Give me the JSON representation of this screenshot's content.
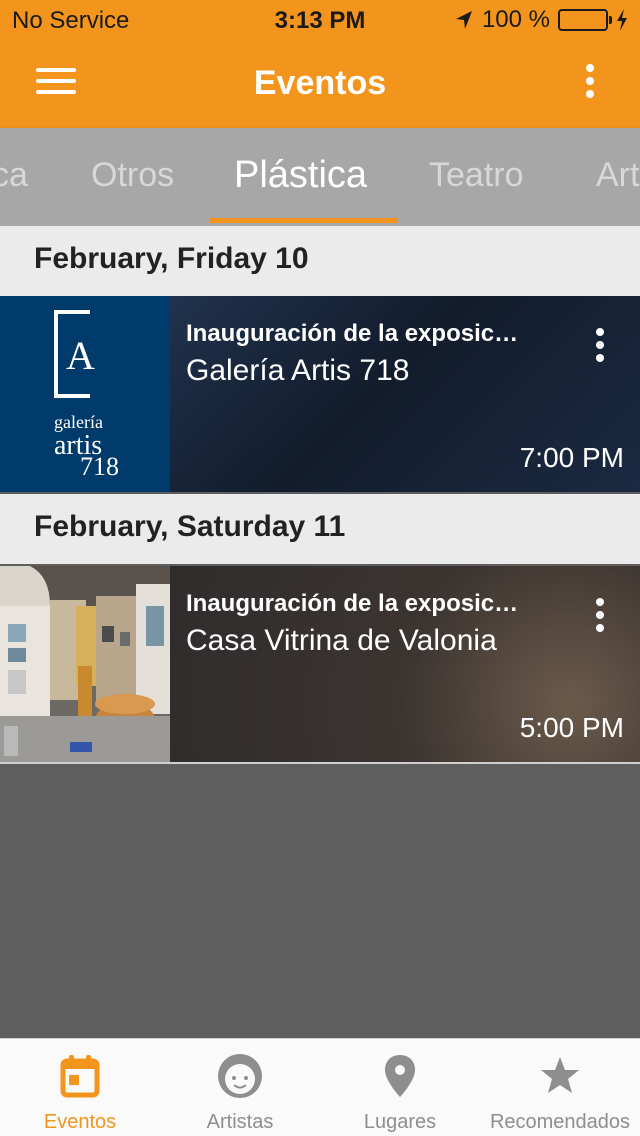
{
  "status_bar": {
    "carrier": "No Service",
    "time": "3:13 PM",
    "battery": "100 %",
    "battery_level": 1.0
  },
  "header": {
    "title": "Eventos",
    "menu_icon": "hamburger-menu-icon",
    "overflow_icon": "more-vertical-icon"
  },
  "category_tabs": [
    {
      "label": "ca",
      "active": false
    },
    {
      "label": "Otros",
      "active": false
    },
    {
      "label": "Plástica",
      "active": true
    },
    {
      "label": "Teatro",
      "active": false
    },
    {
      "label": "Art",
      "active": false
    }
  ],
  "sections": [
    {
      "date": "February, Friday 10",
      "events": [
        {
          "title": "Inauguración de la exposic…",
          "venue": "Galería Artis 718",
          "time": "7:00 PM",
          "logo": {
            "line1": "galería",
            "line2": "artis",
            "line3": "718",
            "mark": "A"
          }
        }
      ]
    },
    {
      "date": "February, Saturday 11",
      "events": [
        {
          "title": "Inauguración de la exposic…",
          "venue": "Casa Vitrina de Valonia",
          "time": "5:00 PM"
        }
      ]
    }
  ],
  "bottom_tabs": [
    {
      "label": "Eventos",
      "icon": "calendar-icon",
      "active": true
    },
    {
      "label": "Artistas",
      "icon": "face-icon",
      "active": false
    },
    {
      "label": "Lugares",
      "icon": "map-pin-icon",
      "active": false
    },
    {
      "label": "Recomendados",
      "icon": "star-icon",
      "active": false
    }
  ],
  "colors": {
    "accent": "#f3951d",
    "tab_bar_bg": "#a7a7a7",
    "section_bg": "#ebebeb",
    "page_bg": "#5e5e5e"
  }
}
